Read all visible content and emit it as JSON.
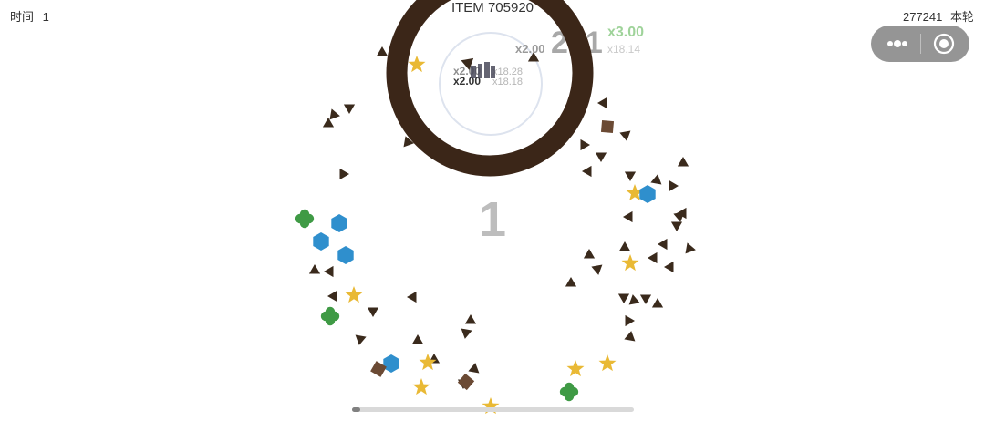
{
  "hud": {
    "time_label": "时间",
    "time_value": "1",
    "round_value": "277241",
    "round_label": "本轮",
    "item_title": "ITEM 705920"
  },
  "game": {
    "center_count": "1",
    "progress": 0.03,
    "score_popups": {
      "big_score": "201",
      "multipliers": [
        "x2.00",
        "x3.00",
        "x18.14"
      ],
      "inner_texts": [
        "x2.00",
        "x2.00",
        "x18.28",
        "x18.18"
      ]
    }
  },
  "colors": {
    "ring": "#3b2618",
    "triangle": "#3a2a1c",
    "square": "#6b4a34",
    "star": "#e9b935",
    "hexagon": "#2f8fcd",
    "clover": "#3f9a45",
    "multiplier_green": "#9fd39a",
    "popup_gray": "#9a9a9a"
  },
  "icons": {
    "capsule_left": "more-dots-icon",
    "capsule_right": "record-target-icon"
  }
}
